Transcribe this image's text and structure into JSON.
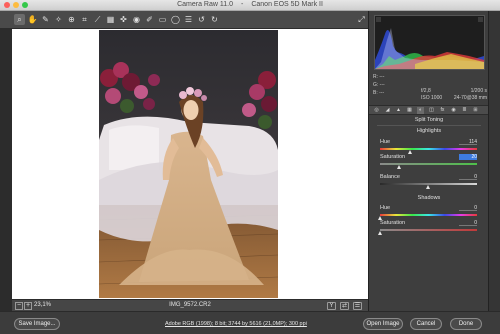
{
  "window": {
    "title": "Camera Raw 11.0",
    "separator": "-",
    "camera_model": "Canon EOS 5D Mark II"
  },
  "colors": {
    "panel_bg": "#3e3e3e",
    "accent": "#3e7be0",
    "stage_bg": "#ffffff"
  },
  "toolbar": {
    "tools": [
      {
        "icon": "zoom-icon",
        "glyph": "⌕"
      },
      {
        "icon": "hand-icon",
        "glyph": "✋"
      },
      {
        "icon": "white-balance-icon",
        "glyph": "✎"
      },
      {
        "icon": "color-sampler-icon",
        "glyph": "✧"
      },
      {
        "icon": "target-adjust-icon",
        "glyph": "⊕"
      },
      {
        "icon": "crop-icon",
        "glyph": "⌗"
      },
      {
        "icon": "straighten-icon",
        "glyph": "⟋"
      },
      {
        "icon": "transform-icon",
        "glyph": "▦"
      },
      {
        "icon": "spot-removal-icon",
        "glyph": "✜"
      },
      {
        "icon": "red-eye-icon",
        "glyph": "◉"
      },
      {
        "icon": "adjustment-brush-icon",
        "glyph": "✐"
      },
      {
        "icon": "graduated-filter-icon",
        "glyph": "▭"
      },
      {
        "icon": "radial-filter-icon",
        "glyph": "◯"
      },
      {
        "icon": "preferences-icon",
        "glyph": "☰"
      },
      {
        "icon": "rotate-ccw-icon",
        "glyph": "↺"
      },
      {
        "icon": "rotate-cw-icon",
        "glyph": "↻"
      }
    ],
    "fullscreen_glyph": "⤢"
  },
  "image": {
    "filename": "IMG_9572.CR2"
  },
  "statusbar": {
    "zoom_out": "−",
    "zoom_in": "+",
    "zoom_level": "23,1%",
    "before_after_label": "Y",
    "compare_label": "⇄",
    "settings_label": "☰"
  },
  "readout": {
    "r_label": "R:",
    "g_label": "G:",
    "b_label": "B:",
    "r_value": "---",
    "g_value": "---",
    "b_value": "---",
    "aperture": "f/2,8",
    "shutter": "1/200 s",
    "iso": "ISO 1000",
    "lens": "24-70@38 mm"
  },
  "panel_tabs": [
    {
      "icon": "basic-icon",
      "glyph": "◎"
    },
    {
      "icon": "tone-curve-icon",
      "glyph": "◢"
    },
    {
      "icon": "detail-icon",
      "glyph": "▲"
    },
    {
      "icon": "hsl-icon",
      "glyph": "▦"
    },
    {
      "icon": "split-toning-icon",
      "glyph": "◐"
    },
    {
      "icon": "lens-corrections-icon",
      "glyph": "◫"
    },
    {
      "icon": "effects-icon",
      "glyph": "fx"
    },
    {
      "icon": "calibration-icon",
      "glyph": "◉"
    },
    {
      "icon": "presets-icon",
      "glyph": "≣"
    },
    {
      "icon": "snapshots-icon",
      "glyph": "⊞"
    }
  ],
  "split_toning": {
    "title": "Split Toning",
    "highlights": {
      "section_label": "Highlights",
      "hue_label": "Hue",
      "hue_value": "114",
      "hue_level": 0.317,
      "saturation_label": "Saturation",
      "saturation_value": "20",
      "saturation_level": 0.2
    },
    "balance": {
      "label": "Balance",
      "value": "0",
      "level": 0.5
    },
    "shadows": {
      "section_label": "Shadows",
      "hue_label": "Hue",
      "hue_value": "0",
      "hue_level": 0.0,
      "saturation_label": "Saturation",
      "saturation_value": "0",
      "saturation_level": 0.0
    }
  },
  "bottombar": {
    "save_label": "Save Image...",
    "workflow_info": "Adobe RGB (1998); 8 bit; 3744 by 5616 (21,0MP); 300 ppi",
    "open_label": "Open Image",
    "cancel_label": "Cancel",
    "done_label": "Done"
  }
}
